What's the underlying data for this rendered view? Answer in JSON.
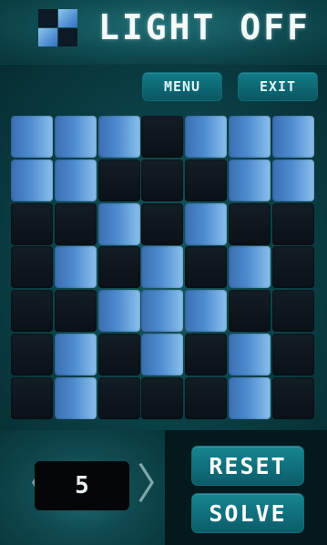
{
  "header": {
    "title": "LIGHT OFF"
  },
  "toolbar": {
    "menu_label": "MENU",
    "exit_label": "EXIT"
  },
  "board": {
    "rows": 7,
    "cols": 7,
    "lit": [
      [
        1,
        1,
        1,
        0,
        1,
        1,
        1
      ],
      [
        1,
        1,
        0,
        0,
        0,
        1,
        1
      ],
      [
        0,
        0,
        1,
        0,
        1,
        0,
        0
      ],
      [
        0,
        1,
        0,
        1,
        0,
        1,
        0
      ],
      [
        0,
        0,
        1,
        1,
        1,
        0,
        0
      ],
      [
        0,
        1,
        0,
        1,
        0,
        1,
        0
      ],
      [
        0,
        1,
        0,
        0,
        0,
        1,
        0
      ]
    ],
    "on_color": "#4d8bd0",
    "off_color": "#0d141b"
  },
  "level": {
    "value": "5"
  },
  "controls": {
    "reset_label": "RESET",
    "solve_label": "SOLVE"
  },
  "icons": {
    "prev": "chevron-left-icon",
    "next": "chevron-right-icon",
    "logo": "checkered-logo-icon"
  }
}
